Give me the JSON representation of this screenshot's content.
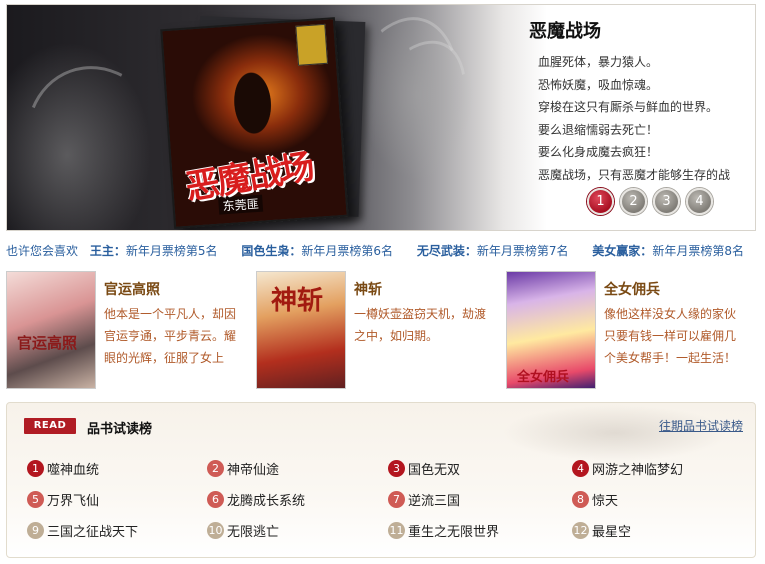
{
  "banner": {
    "title": "恶魔战场",
    "cover_title": "恶魔战场",
    "cover_author": "东莞匪",
    "lines": [
      "血腥死体，暴力猿人。",
      "恐怖妖魔，吸血惊魂。",
      "穿梭在这只有厮杀与鲜血的世界。",
      "要么退缩懦弱去死亡！",
      "要么化身成魔去疯狂！",
      "恶魔战场，只有恶魔才能够生存的战"
    ],
    "pages": [
      "1",
      "2",
      "3",
      "4"
    ],
    "active_page": "1"
  },
  "recommend": {
    "lead": "也许您会喜欢",
    "items": [
      {
        "name": "王主：",
        "rank": "新年月票榜第5名"
      },
      {
        "name": "国色生枭：",
        "rank": "新年月票榜第6名"
      },
      {
        "name": "无尽武装：",
        "rank": "新年月票榜第7名"
      },
      {
        "name": "美女赢家：",
        "rank": "新年月票榜第8名"
      }
    ]
  },
  "featured": [
    {
      "title": "官运高照",
      "desc": "他本是一个平凡人，却因官运亨通，平步青云。耀眼的光辉，征服了女上",
      "cover_text": "官运高照"
    },
    {
      "title": "神斩",
      "desc": "一樽妖壶盗窃天机，劫渡之中，如归期。",
      "cover_text": "神斩"
    },
    {
      "title": "全女佣兵",
      "desc": "像他这样没女人缘的家伙只要有钱一样可以雇佣几个美女帮手！一起生活！",
      "cover_text": "全女佣兵"
    }
  ],
  "readlist": {
    "badge": "READ",
    "title": "品书试读榜",
    "past_link": "往期品书试读榜",
    "items": [
      {
        "num": "1",
        "name": "噬神血统"
      },
      {
        "num": "2",
        "name": "神帝仙途"
      },
      {
        "num": "3",
        "name": "国色无双"
      },
      {
        "num": "4",
        "name": "网游之神临梦幻"
      },
      {
        "num": "5",
        "name": "万界飞仙"
      },
      {
        "num": "6",
        "name": "龙腾成长系统"
      },
      {
        "num": "7",
        "name": "逆流三国"
      },
      {
        "num": "8",
        "name": "惊天"
      },
      {
        "num": "9",
        "name": "三国之征战天下"
      },
      {
        "num": "10",
        "name": "无限逃亡"
      },
      {
        "num": "11",
        "name": "重生之无限世界"
      },
      {
        "num": "12",
        "name": "最星空"
      }
    ]
  },
  "colors": {
    "accent_red": "#b01c24",
    "link_blue": "#2a5f9e",
    "desc_brown": "#b05a2a"
  }
}
